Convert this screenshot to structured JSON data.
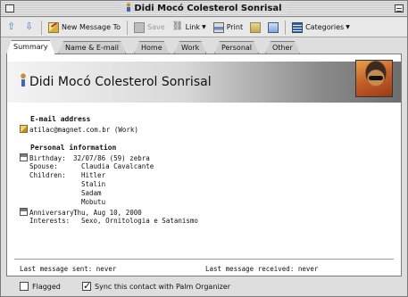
{
  "window": {
    "title": "Didi Mocó Colesterol Sonrisal"
  },
  "toolbar": {
    "new_message": "New Message To",
    "save": "Save",
    "link": "Link",
    "print": "Print",
    "categories": "Categories"
  },
  "tabs": [
    "Summary",
    "Name & E-mail",
    "Home",
    "Work",
    "Personal",
    "Other"
  ],
  "contact": {
    "name": "Didi Mocó Colesterol Sonrisal"
  },
  "email_section": {
    "title": "E-mail address",
    "address": "atilac@magnet.com.br",
    "type": "(Work)"
  },
  "personal_section": {
    "title": "Personal information",
    "birthday_label": "Birthday:",
    "birthday_value": "32/07/86 (59) zebra",
    "spouse_label": "Spouse:",
    "spouse_value": "Claudia Cavalcante",
    "children_label": "Children:",
    "children": [
      "Hitler",
      "Stalin",
      "Sadam",
      "Mobutu"
    ],
    "anniversary_label": "Anniversary:",
    "anniversary_value": "Thu, Aug 10, 2000",
    "interests_label": "Interests:",
    "interests_value": "Sexo, Ornitologia e Satanismo"
  },
  "status": {
    "last_sent": "Last message sent: never",
    "last_received": "Last message received: never"
  },
  "footer": {
    "flagged_label": "Flagged",
    "flagged_checked": false,
    "sync_label": "Sync this contact with Palm Organizer",
    "sync_checked": true
  }
}
